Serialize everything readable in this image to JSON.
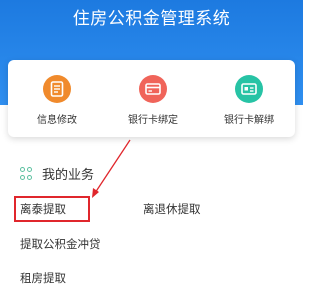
{
  "header": {
    "title": "住房公积金管理系统"
  },
  "quick_actions": [
    {
      "label": "信息修改",
      "icon": "document-icon",
      "color": "#f08a2c"
    },
    {
      "label": "银行卡绑定",
      "icon": "bank-card-icon",
      "color": "#f0645a"
    },
    {
      "label": "银行卡解绑",
      "icon": "card-unbind-icon",
      "color": "#27c3a5"
    }
  ],
  "business": {
    "title": "我的业务",
    "items": [
      "离泰提取",
      "离退休提取",
      "提取公积金冲贷",
      "租房提取"
    ]
  },
  "annotation_color": "#e0262c"
}
